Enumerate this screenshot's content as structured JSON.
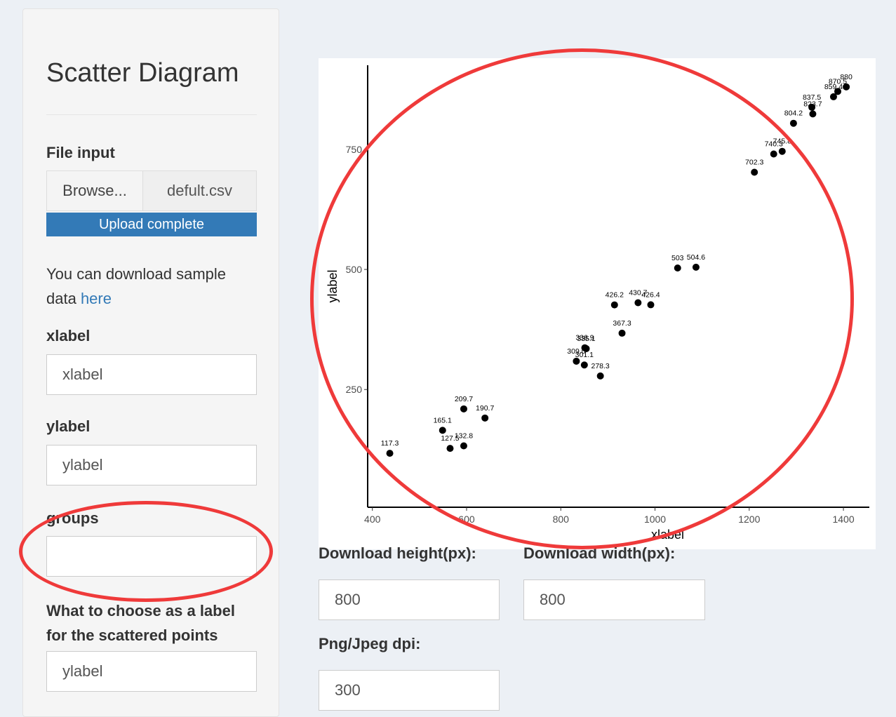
{
  "sidebar": {
    "title": "Scatter Diagram",
    "file_input": {
      "label": "File input",
      "browse_label": "Browse...",
      "file_name": "defult.csv",
      "progress_label": "Upload complete",
      "progress_fraction": 1.0
    },
    "help_text": "You can download sample data ",
    "help_link": "here",
    "xlabel": {
      "label": "xlabel",
      "value": "xlabel"
    },
    "ylabel": {
      "label": "ylabel",
      "value": "ylabel"
    },
    "groups": {
      "label": "groups",
      "value": ""
    },
    "point_label": {
      "label": "What to choose as a label for the scattered points",
      "value": "ylabel"
    }
  },
  "download": {
    "height_label": "Download height(px):",
    "height_value": "800",
    "width_label": "Download width(px):",
    "width_value": "800",
    "dpi_label": "Png/Jpeg dpi:",
    "dpi_value": "300"
  },
  "colors": {
    "accent": "#337ab7",
    "annotation": "#ef3a3a"
  },
  "chart_data": {
    "type": "scatter",
    "xlabel": "xlabel",
    "ylabel": "ylabel",
    "xlim": [
      390,
      1455
    ],
    "ylim": [
      5,
      925
    ],
    "x_ticks": [
      400,
      600,
      800,
      1000,
      1200,
      1400
    ],
    "y_ticks": [
      250,
      500,
      750
    ],
    "grid": false,
    "points": [
      {
        "x": 437,
        "y": 117.3,
        "label": "117.3"
      },
      {
        "x": 549,
        "y": 165.1,
        "label": "165.1"
      },
      {
        "x": 565,
        "y": 127.5,
        "label": "127.5"
      },
      {
        "x": 594,
        "y": 132.8,
        "label": "132.8"
      },
      {
        "x": 594,
        "y": 209.7,
        "label": "209.7"
      },
      {
        "x": 639,
        "y": 190.7,
        "label": "190.7"
      },
      {
        "x": 833,
        "y": 309.0,
        "label": "309.0"
      },
      {
        "x": 850,
        "y": 301.1,
        "label": "301.1"
      },
      {
        "x": 851,
        "y": 336.9,
        "label": "336.9"
      },
      {
        "x": 854,
        "y": 335.1,
        "label": "335.1"
      },
      {
        "x": 884,
        "y": 278.3,
        "label": "278.3"
      },
      {
        "x": 930,
        "y": 367.3,
        "label": "367.3"
      },
      {
        "x": 914,
        "y": 426.2,
        "label": "426.2"
      },
      {
        "x": 964,
        "y": 430.7,
        "label": "430.7"
      },
      {
        "x": 991,
        "y": 426.4,
        "label": "426.4"
      },
      {
        "x": 1048,
        "y": 503,
        "label": "503"
      },
      {
        "x": 1087,
        "y": 504.6,
        "label": "504.6"
      },
      {
        "x": 1211,
        "y": 702.3,
        "label": "702.3"
      },
      {
        "x": 1252,
        "y": 740.3,
        "label": "740.3"
      },
      {
        "x": 1270,
        "y": 745.8,
        "label": "745.8"
      },
      {
        "x": 1294,
        "y": 804.2,
        "label": "804.2"
      },
      {
        "x": 1335,
        "y": 823.7,
        "label": "823.7"
      },
      {
        "x": 1333,
        "y": 837.5,
        "label": "837.5"
      },
      {
        "x": 1379,
        "y": 859.4,
        "label": "859.4"
      },
      {
        "x": 1388,
        "y": 870.5,
        "label": "870.5"
      },
      {
        "x": 1406,
        "y": 880,
        "label": "880"
      }
    ]
  }
}
